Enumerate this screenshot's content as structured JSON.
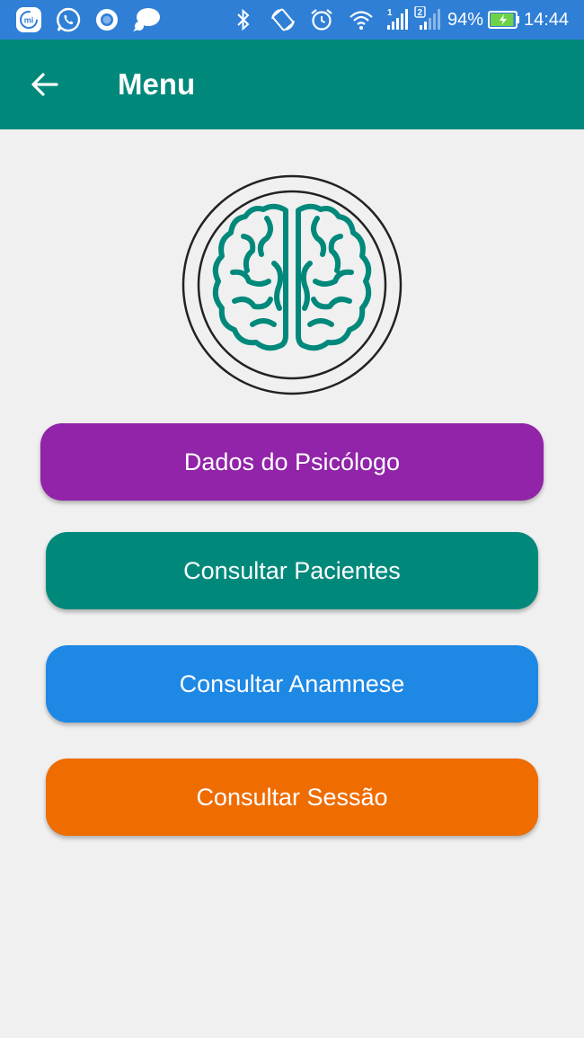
{
  "status_bar": {
    "icons_left": [
      "mi-icon",
      "whatsapp-icon",
      "chrome-bubble-icon",
      "chat-bubble-icon"
    ],
    "icons_right": [
      "bluetooth-icon",
      "rotate-icon",
      "alarm-icon",
      "wifi-icon",
      "signal-sim1-icon",
      "signal-sim2-icon"
    ],
    "sim1_label": "1",
    "sim2_label": "2",
    "battery_percent": "94%",
    "battery_level": 0.94,
    "time": "14:44"
  },
  "app_bar": {
    "title": "Menu",
    "back_icon": "arrow-left-icon",
    "color": "#00897b"
  },
  "logo": {
    "icon": "brain-icon",
    "color": "#00897b"
  },
  "menu": {
    "buttons": [
      {
        "label": "Dados do Psicólogo",
        "color": "#9124a8"
      },
      {
        "label": "Consultar Pacientes",
        "color": "#00897b"
      },
      {
        "label": "Consultar Anamnese",
        "color": "#1e88e5"
      },
      {
        "label": "Consultar Sessão",
        "color": "#ef6c00"
      }
    ]
  }
}
